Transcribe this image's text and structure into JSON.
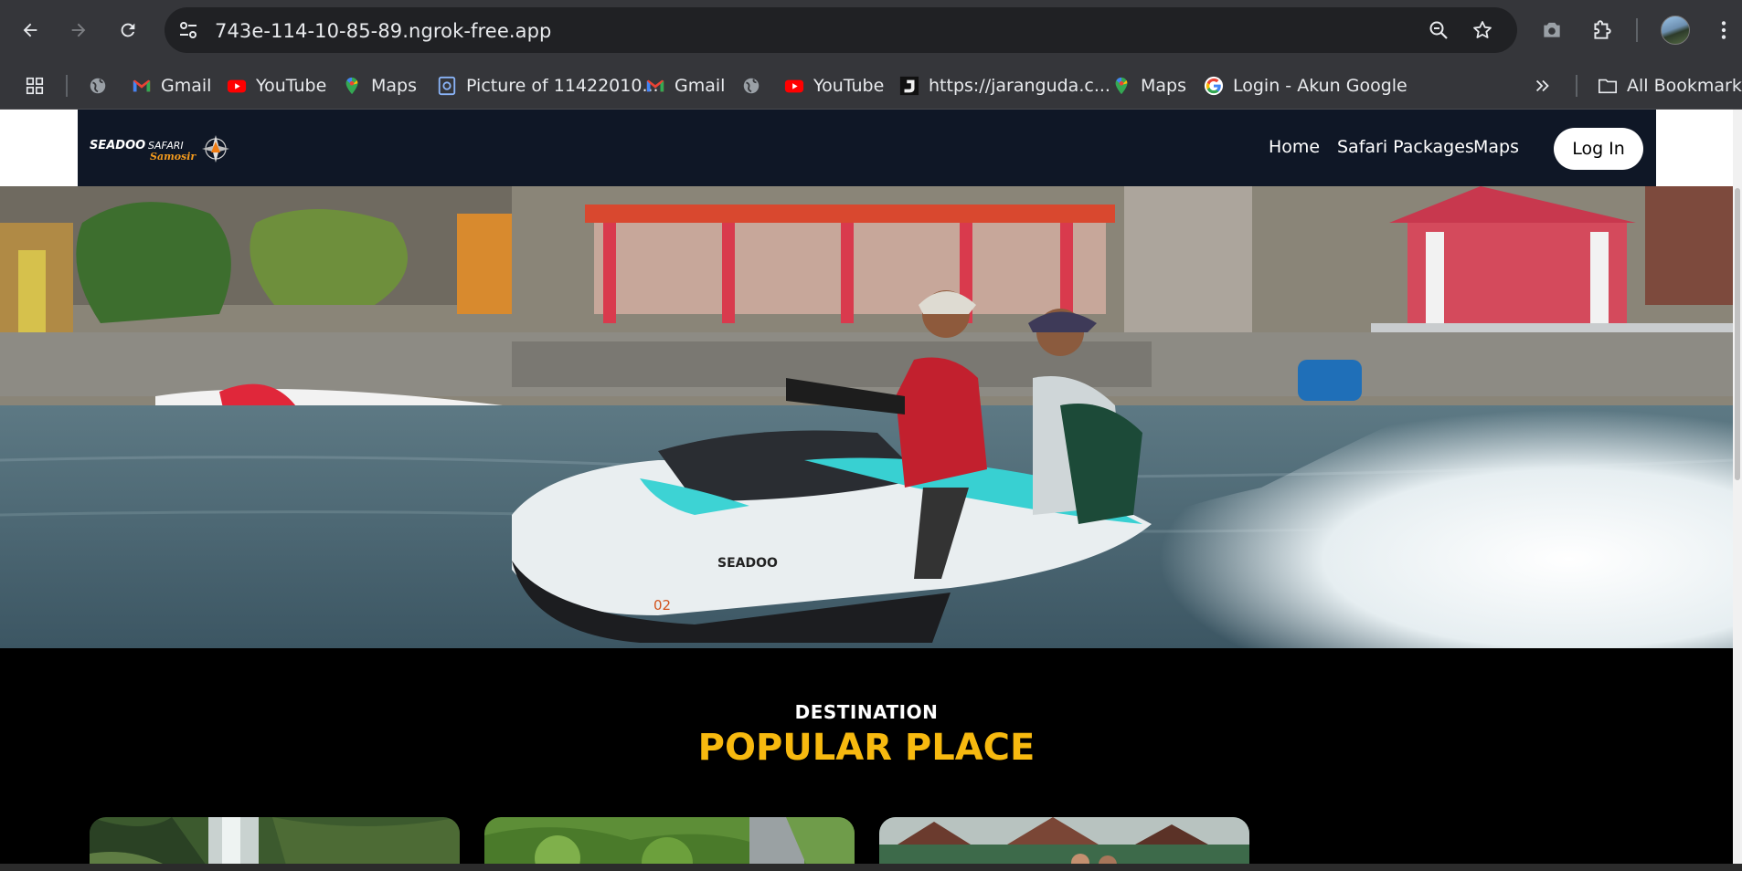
{
  "browser": {
    "url": "743e-114-10-85-89.ngrok-free.app",
    "icons": {
      "back": "back-arrow-icon",
      "forward": "forward-arrow-icon",
      "reload": "reload-icon",
      "site_info": "tune-icon",
      "zoom": "zoom-out-icon",
      "bookmark": "star-icon",
      "screenshot": "camera-icon",
      "extensions": "puzzle-icon",
      "menu": "kebab-menu-icon"
    },
    "bookmarks": [
      {
        "label": "",
        "icon": "apps-grid-icon"
      },
      {
        "label": "",
        "icon": "globe-icon"
      },
      {
        "label": "Gmail",
        "icon": "gmail-icon"
      },
      {
        "label": "YouTube",
        "icon": "youtube-icon"
      },
      {
        "label": "Maps",
        "icon": "maps-icon"
      },
      {
        "label": "Picture of 11422010...",
        "icon": "document-icon"
      },
      {
        "label": "Gmail",
        "icon": "gmail-icon"
      },
      {
        "label": "",
        "icon": "globe-icon"
      },
      {
        "label": "YouTube",
        "icon": "youtube-icon"
      },
      {
        "label": "https://jaranguda.c...",
        "icon": "j-logo-icon"
      },
      {
        "label": "Maps",
        "icon": "maps-icon"
      },
      {
        "label": "Login - Akun Google",
        "icon": "google-icon"
      }
    ],
    "overflow_icon": "double-chevron-icon",
    "all_bookmarks": "All Bookmarks"
  },
  "site": {
    "logo": {
      "brand": "SEADOO",
      "tag": "SAFARI",
      "sub": "Samosir"
    },
    "nav": [
      "Home",
      "Safari Packages",
      "Maps"
    ],
    "login": "Log In",
    "hero": {
      "jetski_brand": "SEADOO",
      "jetski_number": "02"
    }
  },
  "section": {
    "label": "DESTINATION",
    "title": "POPULAR PLACE"
  },
  "colors": {
    "nav_bg": "#0f1726",
    "accent": "#f7b90f",
    "page_bg": "#000000"
  }
}
